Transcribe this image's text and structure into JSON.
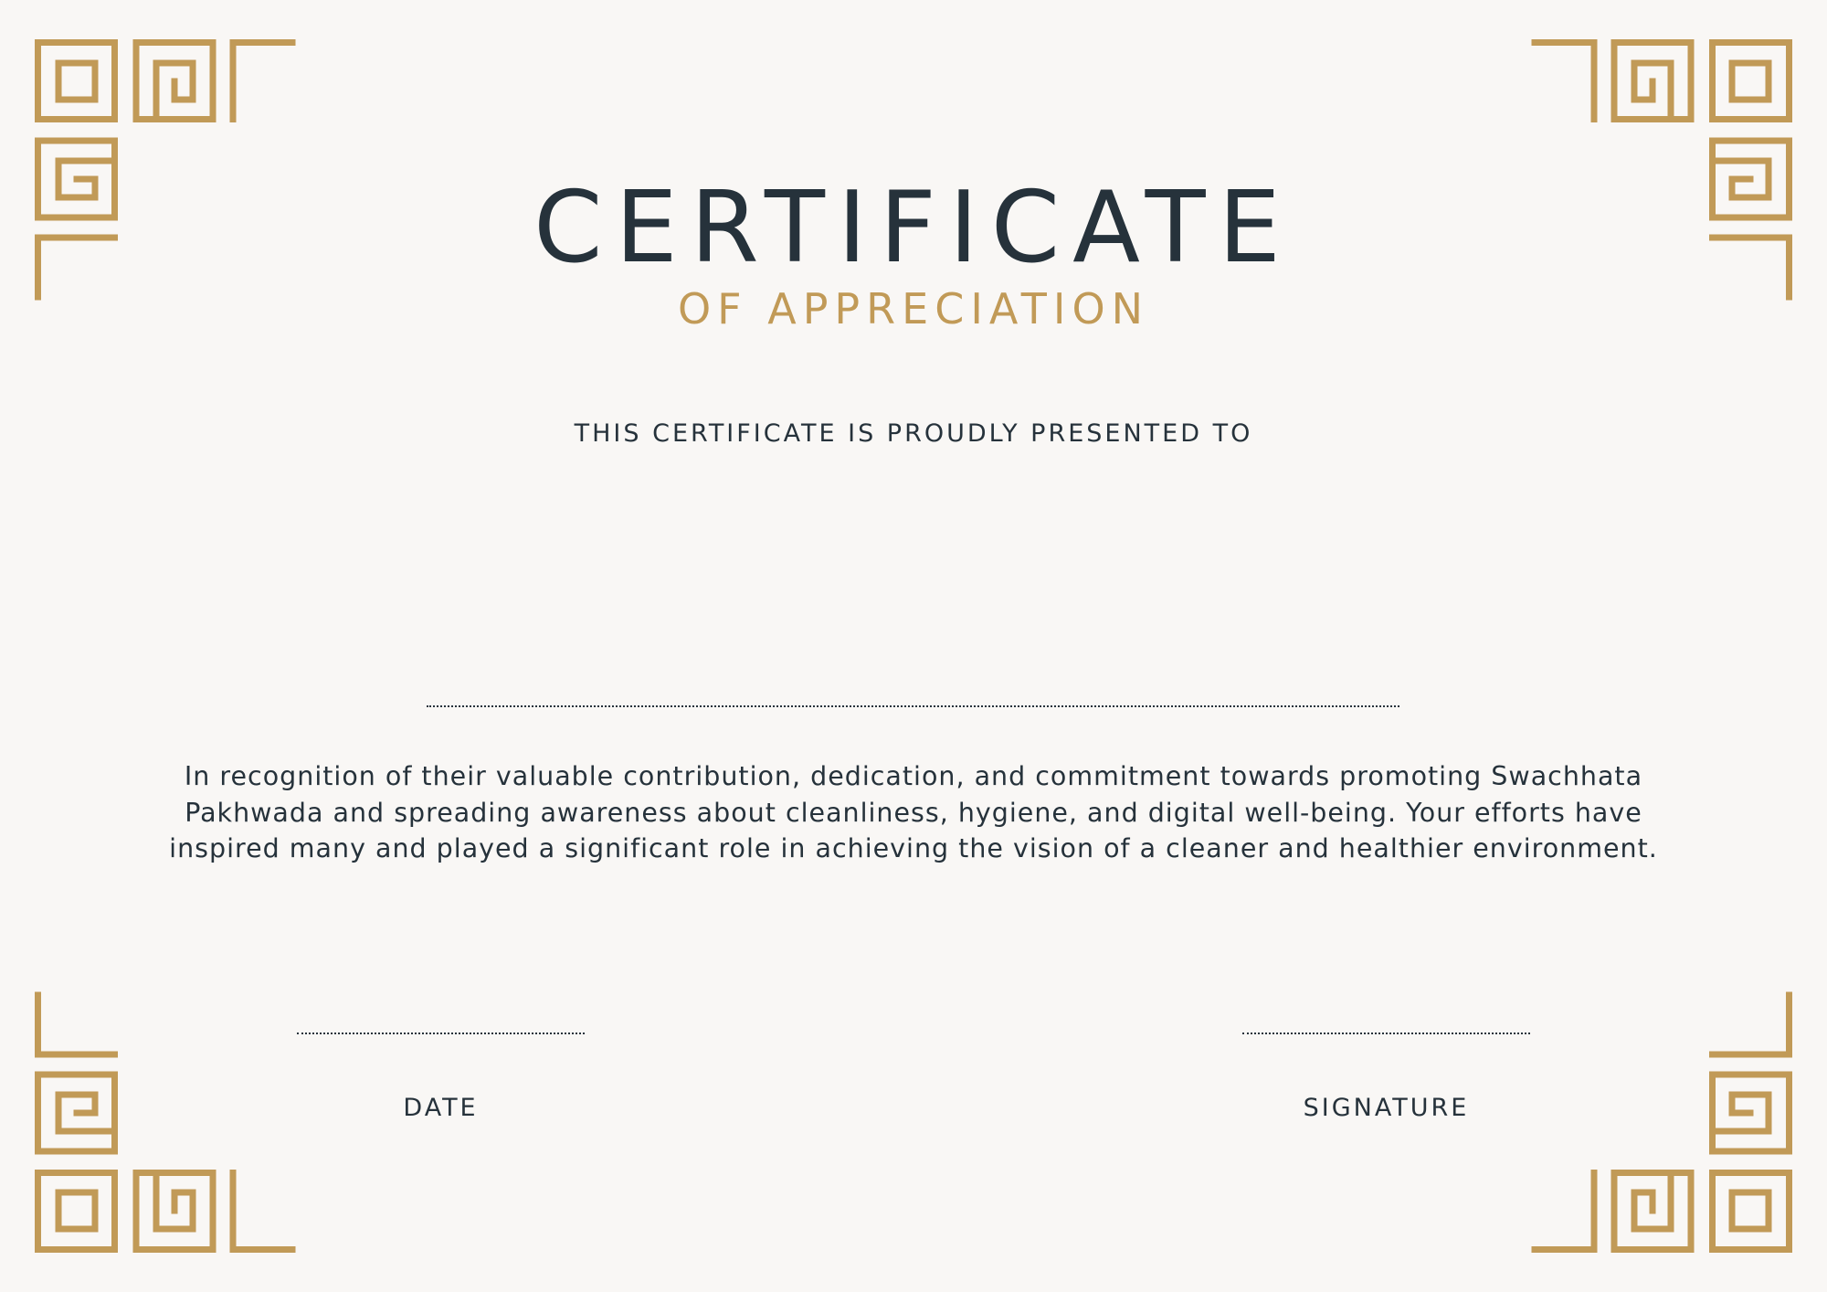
{
  "certificate": {
    "title": "CERTIFICATE",
    "subtitle": "OF APPRECIATION",
    "presented_to": "THIS CERTIFICATE IS PROUDLY PRESENTED TO",
    "body": "In recognition of their valuable contribution, dedication, and commitment towards promoting Swachhata Pakhwada and spreading awareness about cleanliness, hygiene, and digital well-being. Your efforts have inspired many and played a significant role in achieving the vision of a cleaner and healthier environment.",
    "date_label": "DATE",
    "signature_label": "SIGNATURE"
  },
  "colors": {
    "background": "#f9f7f5",
    "text": "#26323b",
    "accent_gold": "#c19a57"
  },
  "decorations": {
    "corner_ornament": "greek-key-meander-icon"
  }
}
